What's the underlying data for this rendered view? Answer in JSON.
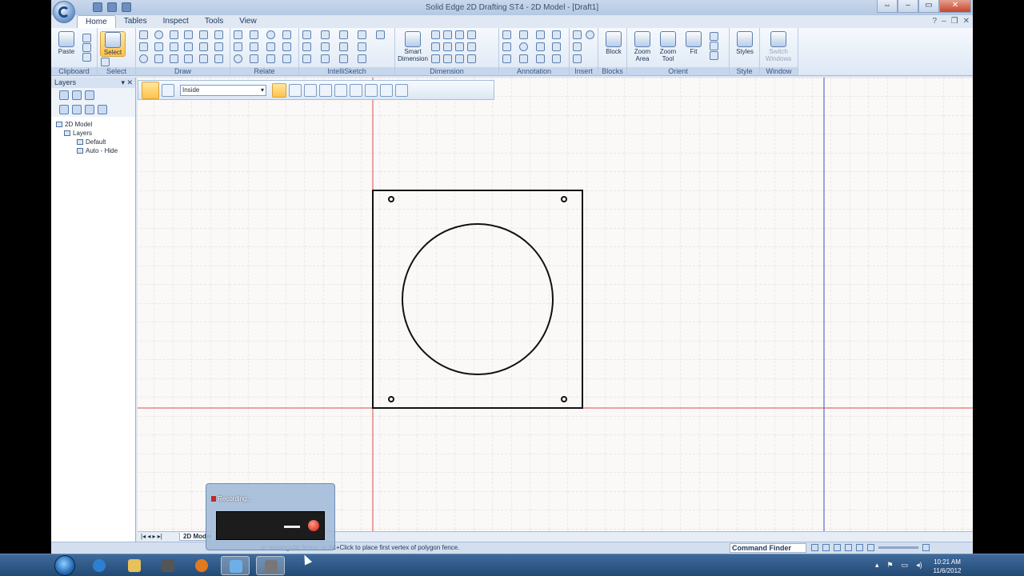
{
  "window": {
    "title": "Solid Edge 2D Drafting ST4 - 2D Model - [Draft1]",
    "controls": [
      "⇔",
      "–",
      "▭",
      "✕"
    ],
    "inner_controls": [
      "?",
      "–",
      "❐",
      "✕"
    ]
  },
  "tabs": [
    {
      "label": "Home",
      "active": true
    },
    {
      "label": "Tables"
    },
    {
      "label": "Inspect"
    },
    {
      "label": "Tools"
    },
    {
      "label": "View"
    }
  ],
  "ribbon": {
    "groups": {
      "clipboard": "Clipboard",
      "select": "Select",
      "draw": "Draw",
      "relate": "Relate",
      "intellisketch": "IntelliSketch",
      "dimension": "Dimension",
      "annotation": "Annotation",
      "insert": "Insert",
      "blocks": "Blocks",
      "orient": "Orient",
      "style": "Style",
      "window": "Window"
    },
    "buttons": {
      "paste": "Paste",
      "select": "Select",
      "smart_dimension": "Smart Dimension",
      "block": "Block",
      "zoom_area": "Zoom Area",
      "zoom_tool": "Zoom Tool",
      "fit": "Fit",
      "styles": "Styles",
      "switch_windows": "Switch Windows"
    }
  },
  "layers_panel": {
    "title": "Layers",
    "tree": [
      "2D Model",
      "Layers",
      "Default",
      "Auto - Hide"
    ]
  },
  "command_bar": {
    "select_option": "Inside"
  },
  "sheet_tab": "2D Model",
  "statusbar": {
    "prompt": "or rectangular fence, or Alt+Click to place first vertex of polygon fence.",
    "command_finder": "Command Finder"
  },
  "recorder": {
    "title": "Recording..."
  },
  "taskbar": {
    "time": "10:21 AM",
    "date": "11/6/2012"
  },
  "colors": {
    "red_axis": "#d84a4a",
    "blue_axis": "#3050c8",
    "geometry": "#111111",
    "grid": "#c9c3c0"
  },
  "drawing": {
    "entities": [
      "rectangle",
      "circle",
      "hole-top-left",
      "hole-top-right",
      "hole-bottom-left",
      "hole-bottom-right"
    ]
  }
}
